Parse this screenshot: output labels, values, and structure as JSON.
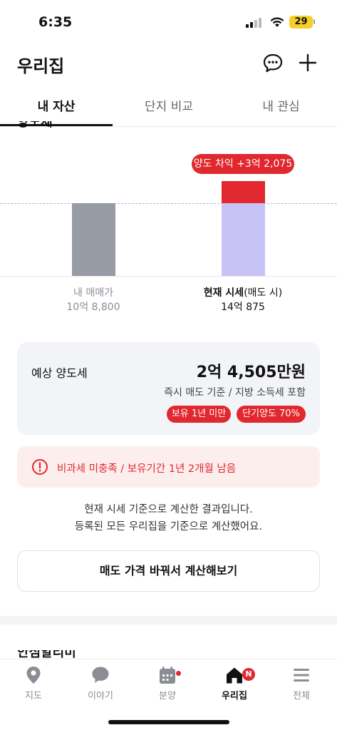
{
  "status": {
    "time": "6:35",
    "battery": "29"
  },
  "header": {
    "title": "우리집"
  },
  "tabs": [
    {
      "label": "내 자산",
      "active": true
    },
    {
      "label": "단지 비교",
      "active": false
    },
    {
      "label": "내 관심",
      "active": false
    }
  ],
  "section_heading_cut": "양도세",
  "chart": {
    "gain_badge": "양도 차익 +3억 2,075",
    "bars": [
      {
        "label": "내 매매가",
        "value": "10억 8,800"
      },
      {
        "label_main": "현재 시세",
        "label_sub": "(매도 시)",
        "value": "14억 875"
      }
    ],
    "colors": {
      "mine": "#979ba3",
      "now": "#c7c3f6",
      "gain": "#e0282e"
    }
  },
  "tax_card": {
    "label": "예상 양도세",
    "amount": "2억 4,505만원",
    "basis": "즉시 매도 기준 / 지방 소득세 포함",
    "chips": [
      "보유 1년 미만",
      "단기양도 70%"
    ]
  },
  "warning": {
    "text": "비과세 미충족 / 보유기간 1년 2개월 남음"
  },
  "notes": [
    "현재 시세 기준으로 계산한 결과입니다.",
    "등록된 모든 우리집을 기준으로 계산했어요."
  ],
  "recalc_button": "매도 가격 바꿔서 계산해보기",
  "next_heading_cut": "안심알리미",
  "bottom_nav": [
    {
      "label": "지도",
      "icon": "map-pin-icon"
    },
    {
      "label": "이야기",
      "icon": "chat-bubble-icon"
    },
    {
      "label": "분양",
      "icon": "calendar-icon"
    },
    {
      "label": "우리집",
      "icon": "house-icon",
      "badge": "N",
      "active": true
    },
    {
      "label": "전체",
      "icon": "menu-icon"
    }
  ],
  "accent_color": "#e0282e"
}
